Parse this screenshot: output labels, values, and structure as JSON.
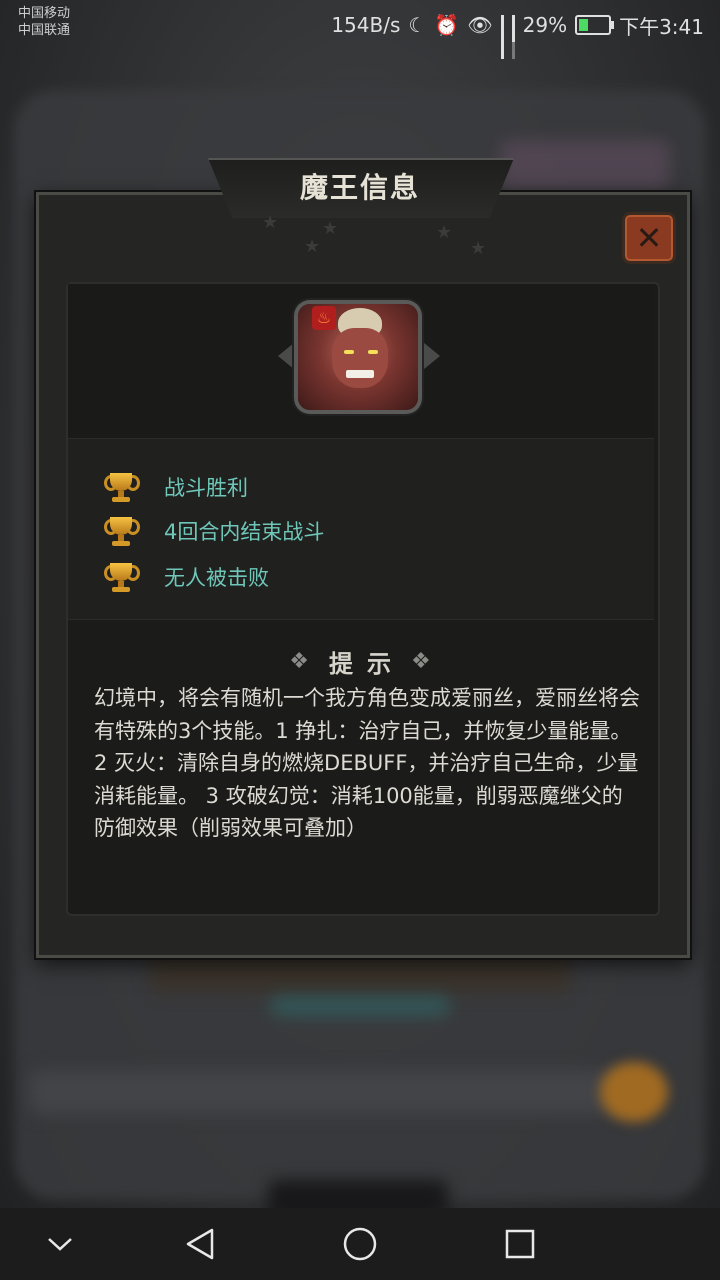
{
  "status_bar": {
    "carrier_1": "中国移动",
    "carrier_2": "中国联通",
    "network_speed": "154B/s",
    "battery": "29%",
    "time": "下午3:41"
  },
  "dialog": {
    "title": "魔王信息"
  },
  "conditions": [
    "战斗胜利",
    "4回合内结束战斗",
    "无人被击败"
  ],
  "hint": {
    "title": "提示",
    "body": "幻境中，将会有随机一个我方角色变成爱丽丝，爱丽丝将会有特殊的3个技能。1 挣扎：治疗自己，并恢复少量能量。   2 灭火：清除自身的燃烧DEBUFF，并治疗自己生命，少量消耗能量。 3 攻破幻觉：消耗100能量，削弱恶魔继父的防御效果（削弱效果可叠加）"
  },
  "colors": {
    "condition_text": "#6ec7b8",
    "close_button": "#8b3a22",
    "trophy": "#f6c342"
  },
  "icons": [
    "moon-icon",
    "alarm-icon",
    "eye-icon",
    "signal-icon",
    "battery-icon",
    "close-icon",
    "trophy-icon",
    "fire-element-icon",
    "chevron-down-icon",
    "back-triangle-icon",
    "home-circle-icon",
    "recents-square-icon"
  ]
}
